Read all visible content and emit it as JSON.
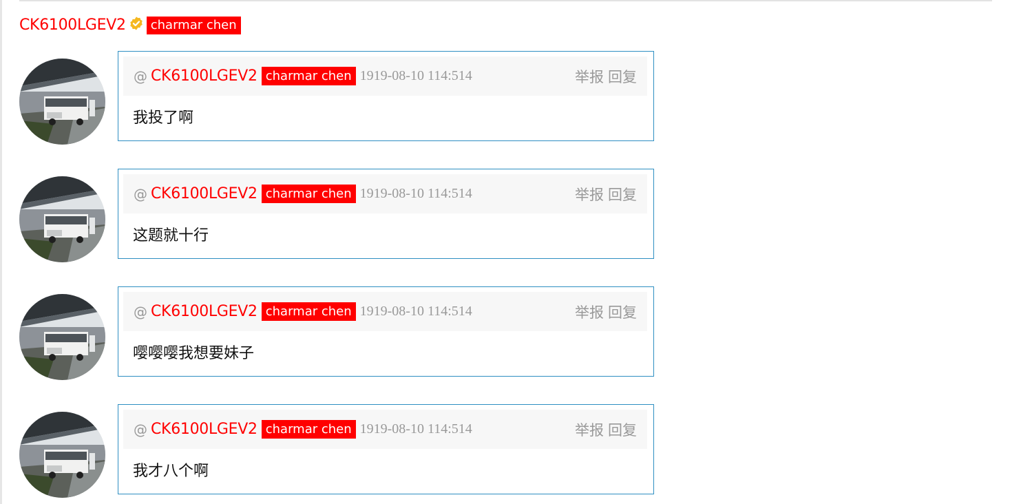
{
  "header": {
    "username": "CK6100LGEV2",
    "tag": "charmar chen",
    "verified_icon": "verified-badge-icon",
    "verified_color": "#f5b820"
  },
  "colors": {
    "username": "#ff0000",
    "tag_bg": "#ff0000",
    "card_border": "#2d8ec2",
    "meta_gray": "#999999"
  },
  "comments": [
    {
      "at": "@",
      "username": "CK6100LGEV2",
      "tag": "charmar chen",
      "timestamp": "1919-08-10 114:514",
      "report_label": "举报",
      "reply_label": "回复",
      "text": "我投了啊"
    },
    {
      "at": "@",
      "username": "CK6100LGEV2",
      "tag": "charmar chen",
      "timestamp": "1919-08-10 114:514",
      "report_label": "举报",
      "reply_label": "回复",
      "text": "这题就十行"
    },
    {
      "at": "@",
      "username": "CK6100LGEV2",
      "tag": "charmar chen",
      "timestamp": "1919-08-10 114:514",
      "report_label": "举报",
      "reply_label": "回复",
      "text": "嘤嘤嘤我想要妹子"
    },
    {
      "at": "@",
      "username": "CK6100LGEV2",
      "tag": "charmar chen",
      "timestamp": "1919-08-10 114:514",
      "report_label": "举报",
      "reply_label": "回复",
      "text": "我才八个啊"
    }
  ]
}
